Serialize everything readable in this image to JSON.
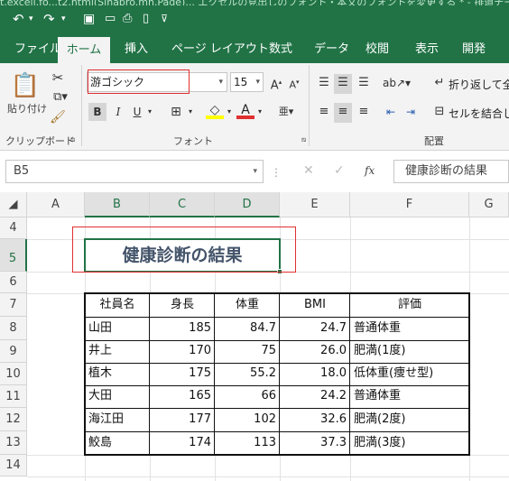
{
  "titlebar": {
    "doc_title": "t.excelj.fo...t2.html(Sinapro.mn.Page)... エクセルの見出しのフォント・本文のフォントを変更する * - 排道チート"
  },
  "ribbon_tabs": [
    "ファイル",
    "ホーム",
    "挿入",
    "ページ レイアウト",
    "数式",
    "データ",
    "校閲",
    "表示",
    "開発"
  ],
  "active_tab": "ホーム",
  "ribbon": {
    "paste_label": "貼り付け",
    "clipboard_group": "クリップボード",
    "font_group": "フォント",
    "alignment_group": "配置",
    "font_name": "游ゴシック",
    "font_size": "15",
    "bold": "B",
    "italic": "I",
    "underline": "U",
    "wrap_text": "折り返して全体",
    "merge_center": "セルを結合して"
  },
  "formula_bar": {
    "name_box": "B5",
    "fx": "fx",
    "content": "健康診断の結果"
  },
  "columns": [
    "A",
    "B",
    "C",
    "D",
    "E",
    "F",
    "G"
  ],
  "rows": [
    "4",
    "5",
    "6",
    "7",
    "8",
    "9",
    "10",
    "11",
    "12",
    "13",
    "14"
  ],
  "sheet": {
    "title_cell": "健康診断の結果",
    "headers": [
      "社員名",
      "身長",
      "体重",
      "BMI",
      "評価"
    ],
    "records": [
      [
        "山田",
        "185",
        "84.7",
        "24.7",
        "普通体重"
      ],
      [
        "井上",
        "170",
        "75",
        "26.0",
        "肥満(1度)"
      ],
      [
        "植木",
        "175",
        "55.2",
        "18.0",
        "低体重(痩せ型)"
      ],
      [
        "大田",
        "165",
        "66",
        "24.2",
        "普通体重"
      ],
      [
        "海江田",
        "177",
        "102",
        "32.6",
        "肥満(2度)"
      ],
      [
        "鮫島",
        "174",
        "113",
        "37.3",
        "肥満(3度)"
      ]
    ]
  },
  "colors": {
    "excel_green": "#217346",
    "highlight_red": "#e03030"
  }
}
